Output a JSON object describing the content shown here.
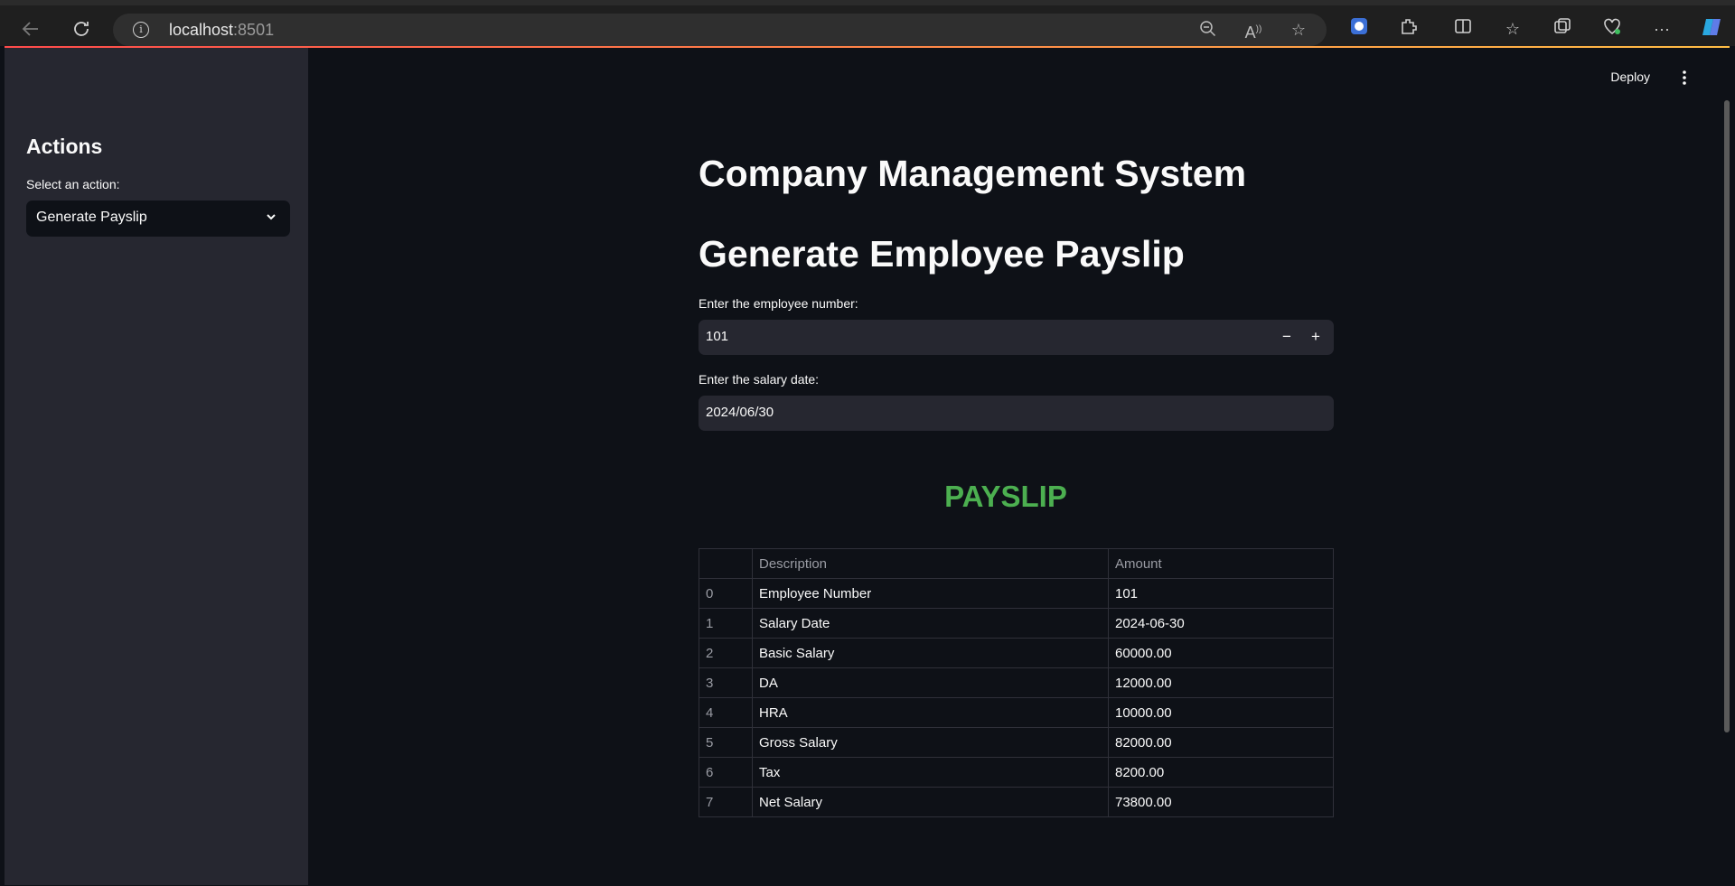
{
  "browser": {
    "url_host": "localhost",
    "url_port": ":8501"
  },
  "sidebar": {
    "title": "Actions",
    "select_label": "Select an action:",
    "select_value": "Generate Payslip"
  },
  "header": {
    "deploy_label": "Deploy"
  },
  "main": {
    "title": "Company Management System",
    "subtitle": "Generate Employee Payslip",
    "employee_label": "Enter the employee number:",
    "employee_value": "101",
    "date_label": "Enter the salary date:",
    "date_value": "2024/06/30",
    "payslip_heading": "PAYSLIP"
  },
  "table": {
    "columns": [
      "",
      "Description",
      "Amount"
    ],
    "rows": [
      {
        "index": "0",
        "description": "Employee Number",
        "amount": "101"
      },
      {
        "index": "1",
        "description": "Salary Date",
        "amount": "2024-06-30"
      },
      {
        "index": "2",
        "description": "Basic Salary",
        "amount": "60000.00"
      },
      {
        "index": "3",
        "description": "DA",
        "amount": "12000.00"
      },
      {
        "index": "4",
        "description": "HRA",
        "amount": "10000.00"
      },
      {
        "index": "5",
        "description": "Gross Salary",
        "amount": "82000.00"
      },
      {
        "index": "6",
        "description": "Tax",
        "amount": "8200.00"
      },
      {
        "index": "7",
        "description": "Net Salary",
        "amount": "73800.00"
      }
    ]
  },
  "colors": {
    "accent_green": "#4caf50",
    "background": "#0e1117",
    "sidebar": "#262730"
  }
}
